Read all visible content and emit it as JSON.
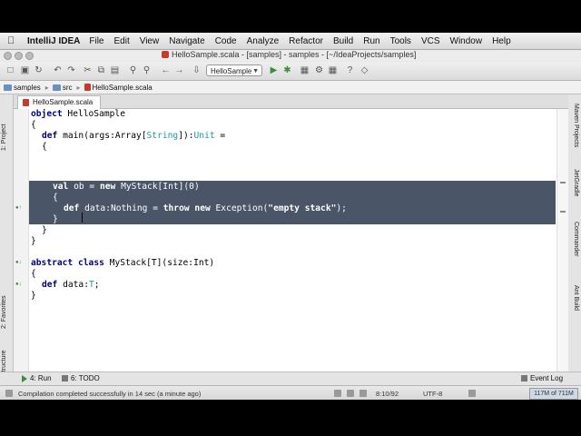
{
  "menubar": {
    "app_name": "IntelliJ IDEA",
    "items": [
      "File",
      "Edit",
      "View",
      "Navigate",
      "Code",
      "Analyze",
      "Refactor",
      "Build",
      "Run",
      "Tools",
      "VCS",
      "Window",
      "Help"
    ]
  },
  "window": {
    "title": "HelloSample.scala - [samples] - samples - [~/IdeaProjects/samples]"
  },
  "toolbar": {
    "run_config": "HelloSample"
  },
  "breadcrumb": [
    "samples",
    "src",
    "HelloSample.scala"
  ],
  "side_tools": {
    "left": [
      "1: Project",
      "2: Favorites",
      "Z: Structure"
    ],
    "right": [
      "Maven Projects",
      "JetGradle",
      "Commander",
      "Ant Build"
    ]
  },
  "editor": {
    "tab_label": "HelloSample.scala"
  },
  "code": {
    "l1": {
      "kw": "object",
      "rest": " HelloSample"
    },
    "l2": "{",
    "l3": {
      "kw": "def",
      "a": " main(args:Array[",
      "ty": "String",
      "b": "]):",
      "un": "Unit",
      "c": " ="
    },
    "l4": "{",
    "l5": {
      "kw": "val",
      "a": " ob = ",
      "kw2": "new",
      "b": " MyStack[Int](0)"
    },
    "l6": "{",
    "l7": {
      "kw": "def",
      "a": " data:Nothing = ",
      "kw2": "throw",
      "b": " ",
      "kw3": "new",
      "c": " Exception(",
      "str": "\"empty stack\"",
      "d": ");"
    },
    "l8": "}",
    "l9": "}",
    "l10": "}",
    "l12": {
      "kw": "abstract",
      "a": " ",
      "kw2": "class",
      "b": " MyStack[T](size:Int)"
    },
    "l13": "{",
    "l14": {
      "kw": "def",
      "a": " data:",
      "ty": "T",
      "b": ";"
    },
    "l15": "}"
  },
  "bottom_tools": {
    "run": "4: Run",
    "todo": "6: TODO",
    "event_log": "Event Log"
  },
  "status": {
    "message": "Compilation completed successfully in 14 sec (a minute ago)",
    "position": "8:10/92",
    "encoding": "UTF-8",
    "memory": "117M of 711M"
  }
}
